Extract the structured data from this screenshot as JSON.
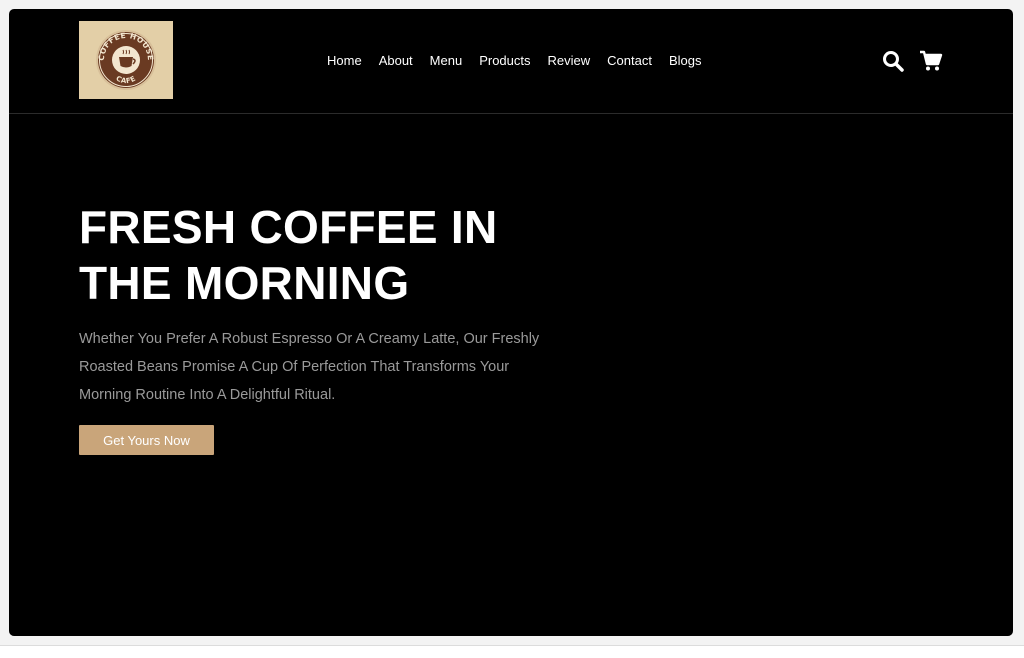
{
  "header": {
    "logo": {
      "top_text": "COFFEE HOUSE",
      "bottom_text": "CAFE"
    },
    "nav": [
      "Home",
      "About",
      "Menu",
      "Products",
      "Review",
      "Contact",
      "Blogs"
    ],
    "icons": [
      "search-icon",
      "cart-icon"
    ]
  },
  "hero": {
    "title_line1": "FRESH COFFEE IN",
    "title_line2": "THE MORNING",
    "text": "Whether You Prefer A Robust Espresso Or A Creamy Latte, Our Freshly Roasted Beans Promise A Cup Of Perfection That Transforms Your Morning Routine Into A Delightful Ritual.",
    "cta_label": "Get Yours Now"
  },
  "colors": {
    "background": "#000000",
    "accent": "#c9a57a",
    "logo_background": "#e3cfa7",
    "body_text": "#9a9a9a"
  }
}
